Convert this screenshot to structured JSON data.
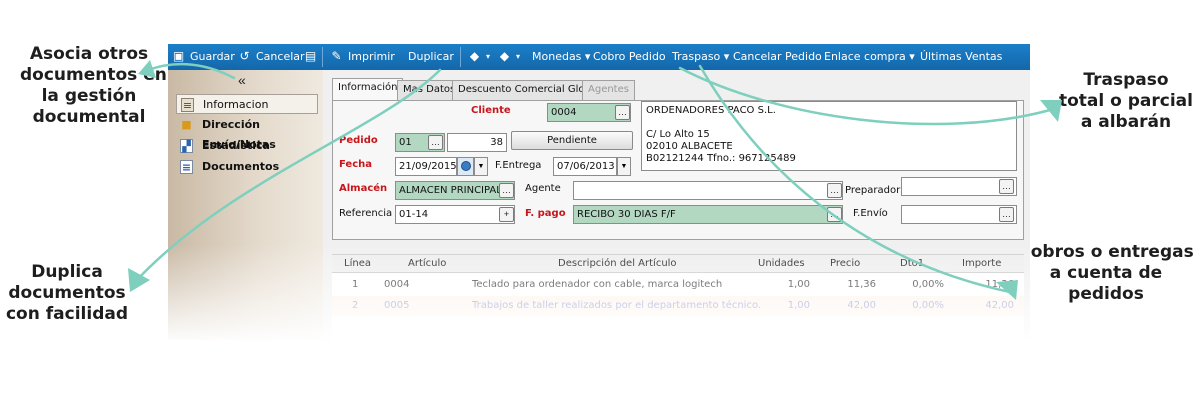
{
  "callouts": {
    "asocia": [
      "Asocia otros",
      "documentos en",
      "la gestión",
      "documental"
    ],
    "duplica": [
      "Duplica",
      "documentos",
      "con facilidad"
    ],
    "traspaso": [
      "Traspaso",
      "total o parcial",
      "a albarán"
    ],
    "cobros": [
      "Cobros o entregas",
      "a cuenta de",
      "pedidos"
    ]
  },
  "colors": {
    "toolbar": "#1b7fc9",
    "arrow": "#7ecfbd",
    "required_label": "#c8151b",
    "green_field": "#b3d8c2"
  },
  "toolbar": {
    "guardar": "Guardar",
    "cancelar": "Cancelar",
    "imprimir": "Imprimir",
    "duplicar": "Duplicar",
    "monedas": "Monedas",
    "cobro_pedido": "Cobro Pedido",
    "traspaso": "Traspaso",
    "cancelar_pedido": "Cancelar Pedido",
    "enlace_compra": "Enlace compra",
    "ultimas_ventas": "Últimas Ventas"
  },
  "sidebar": {
    "collapse": "«",
    "items": [
      {
        "label": "Informacion",
        "icon": "document-icon"
      },
      {
        "label": "Dirección Envío/Notas",
        "icon": "folder-icon"
      },
      {
        "label": "Estadística",
        "icon": "chart-icon"
      },
      {
        "label": "Documentos",
        "icon": "documents-icon"
      }
    ]
  },
  "tabs": [
    "Información",
    "Mas Datos",
    "Descuento Comercial Global",
    "Agentes"
  ],
  "form": {
    "cliente_label": "Cliente",
    "cliente_code": "0004",
    "address": [
      "ORDENADORES PACO S.L.",
      "",
      "C/ Lo Alto 15",
      "02010 ALBACETE",
      "B02121244   Tfno.: 967125489"
    ],
    "pedido_label": "Pedido",
    "pedido_serie": "01",
    "pedido_numero": "38",
    "estado": "Pendiente",
    "fecha_label": "Fecha",
    "fecha": "21/09/2015",
    "fentrega_label": "F.Entrega",
    "fentrega": "07/06/2013",
    "almacen_label": "Almacén",
    "almacen": "ALMACEN PRINCIPAL",
    "agente_label": "Agente",
    "agente": "",
    "preparador_label": "Preparador",
    "preparador": "",
    "referencia_label": "Referencia",
    "referencia": "01-14",
    "fpago_label": "F. pago",
    "fpago": "RECIBO 30 DIAS F/F",
    "fenvio_label": "F.Envío",
    "fenvio": ""
  },
  "grid": {
    "headers": [
      "Línea",
      "Artículo",
      "Descripción del Artículo",
      "Unidades",
      "Precio",
      "Dto1",
      "Importe"
    ],
    "rows": [
      [
        "1",
        "0004",
        "Teclado para ordenador con cable, marca logitech",
        "1,00",
        "11,36",
        "0,00%",
        "11,36"
      ],
      [
        "2",
        "0005",
        "Trabajos de taller realizados por el departamento técnico.",
        "1,00",
        "42,00",
        "0,00%",
        "42,00"
      ]
    ]
  }
}
